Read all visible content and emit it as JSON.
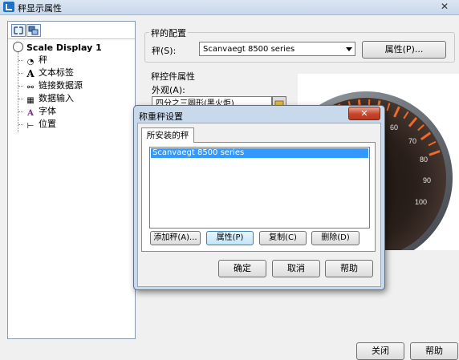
{
  "window": {
    "title": "秤显示属性",
    "close_glyph": "✕"
  },
  "tree": {
    "root": "Scale Display 1",
    "items": [
      {
        "icon": "gauge-icon",
        "glyph": "◔",
        "label": "秤"
      },
      {
        "icon": "text-icon",
        "glyph": "A",
        "label": "文本标签"
      },
      {
        "icon": "link-icon",
        "glyph": "⚯",
        "label": "链接数据源"
      },
      {
        "icon": "keyboard-icon",
        "glyph": "▦",
        "label": "数据输入"
      },
      {
        "icon": "font-icon",
        "glyph": "A",
        "label": "字体"
      },
      {
        "icon": "position-icon",
        "glyph": "⊢",
        "label": "位置"
      }
    ]
  },
  "scale_config": {
    "group_title": "秤的配置",
    "scale_label": "秤(S):",
    "scale_value": "Scanvaegt 8500 series",
    "properties_button": "属性(P)..."
  },
  "control_props": {
    "group_title": "秤控件属性",
    "appearance_label": "外观(A):",
    "appearance_value": "四分之三圆形(黑火炬)"
  },
  "gauge": {
    "ticks": [
      "60",
      "70",
      "80",
      "90",
      "100"
    ],
    "accent_color": "#f06a28"
  },
  "dialog": {
    "title": "称重秤设置",
    "close_glyph": "✕",
    "tab_label": "所安装的秤",
    "list_items": [
      "Scanvaegt 8500 series"
    ],
    "buttons": {
      "add": "添加秤(A)...",
      "properties": "属性(P)",
      "copy": "复制(C)",
      "delete": "删除(D)",
      "ok": "确定",
      "cancel": "取消",
      "help": "帮助"
    }
  },
  "footer": {
    "close_button": "关闭",
    "help_button": "帮助"
  }
}
